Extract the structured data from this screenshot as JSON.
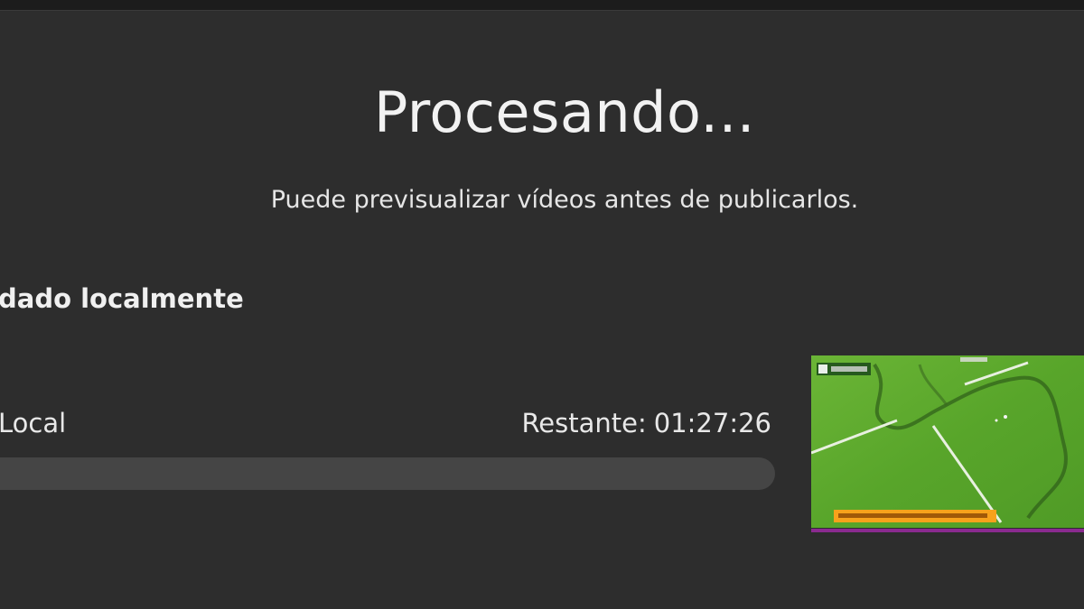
{
  "dialog": {
    "title": "Procesando...",
    "subtitle": "Puede previsualizar vídeos antes de publicarlos."
  },
  "section": {
    "heading": "dado localmente"
  },
  "task": {
    "label": "Local",
    "remaining_label": "Restante:",
    "remaining_time": "01:27:26",
    "progress": 0
  },
  "thumbnail": {
    "icon": "video-thumbnail",
    "accent_color": "#f7a21b",
    "field_color": "#5fae2c",
    "bottom_bar_color": "#8a2a8f"
  }
}
